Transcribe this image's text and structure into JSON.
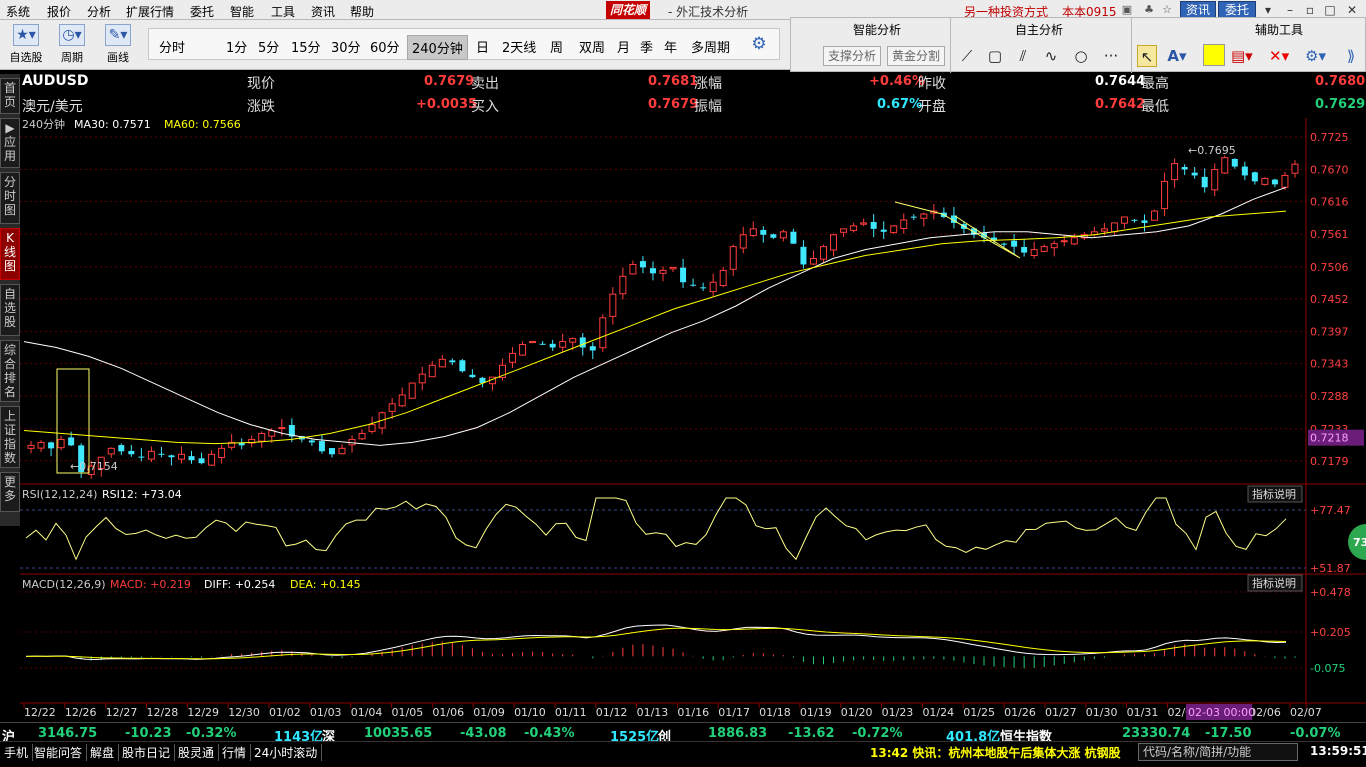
{
  "menu": [
    "系统",
    "报价",
    "分析",
    "扩展行情",
    "委托",
    "智能",
    "工具",
    "资讯",
    "帮助"
  ],
  "app_logo": "同花顺",
  "window_title": "- 外汇技术分析",
  "other_invest": "另一种投资方式",
  "user_name": "本本0915",
  "news_label": "资讯",
  "entrust_label": "委托",
  "toolbar": {
    "self_stock": "自选股",
    "period_label": "周期",
    "draw_label": "画线",
    "periods": [
      "分时",
      "1分",
      "5分",
      "15分",
      "30分",
      "60分",
      "240分钟",
      "日",
      "2天线",
      "周",
      "双周",
      "月",
      "季",
      "年",
      "多周期"
    ],
    "active_period": "240分钟"
  },
  "analysis_panel": {
    "smart_title": "智能分析",
    "self_title": "自主分析",
    "aux_title": "辅助工具",
    "btn_support": "支撑分析",
    "btn_golden": "黄金分割"
  },
  "left_tabs": [
    "首页",
    "应用",
    "分时图",
    "K线图",
    "自选股",
    "综合排名",
    "上证指数",
    "更多"
  ],
  "quote": {
    "symbol": "AUDUSD",
    "name": "澳元/美元",
    "price_label": "现价",
    "price": "0.7679",
    "change_label": "涨跌",
    "change": "+0.0035",
    "sell_label": "卖出",
    "sell": "0.7681",
    "buy_label": "买入",
    "buy": "0.7679",
    "pct_label": "涨幅",
    "pct": "+0.46%",
    "amp_label": "振幅",
    "amp": "0.67%",
    "prev_label": "昨收",
    "prev": "0.7644",
    "open_label": "开盘",
    "open": "0.7642",
    "high_label": "最高",
    "high": "0.7680",
    "low_label": "最低",
    "low": "0.7629"
  },
  "main_legend": {
    "period": "240分钟",
    "ma30": "MA30: 0.7571",
    "ma60": "MA60: 0.7566"
  },
  "rsi_legend": {
    "name": "RSI(12,12,24)",
    "rsi12": "RSI12: +73.04"
  },
  "macd_legend": {
    "name": "MACD(12,26,9)",
    "macd": "MACD: +0.219",
    "diff": "DIFF: +0.254",
    "dea": "DEA: +0.145"
  },
  "indicator_explain": "指标说明",
  "price_axis": [
    "0.7725",
    "0.7670",
    "0.7616",
    "0.7561",
    "0.7506",
    "0.7452",
    "0.7397",
    "0.7343",
    "0.7288",
    "0.7233",
    "0.7179"
  ],
  "current_price_tag": "0.7218",
  "rsi_axis": [
    "+77.47",
    "+51.87"
  ],
  "macd_axis": [
    "+0.478",
    "+0.205",
    "-0.075"
  ],
  "rsi_badge": "73",
  "date_axis": [
    "12/22",
    "12/26",
    "12/27",
    "12/28",
    "12/29",
    "12/30",
    "01/02",
    "01/03",
    "01/04",
    "01/05",
    "01/06",
    "01/09",
    "01/10",
    "01/11",
    "01/12",
    "01/13",
    "01/16",
    "01/17",
    "01/18",
    "01/19",
    "01/20",
    "01/23",
    "01/24",
    "01/25",
    "01/26",
    "01/27",
    "01/30",
    "01/31",
    "02/01",
    "02/02",
    "02/06",
    "02/07"
  ],
  "cursor_date": "02-03 00:00",
  "annot_high": "0.7695",
  "annot_low": "0.7154",
  "chart_data": {
    "type": "candlestick",
    "price_range": [
      0.715,
      0.774
    ],
    "rsi_range": [
      30,
      90
    ],
    "macd_range": [
      -0.3,
      0.55
    ],
    "close_path": [
      0.7205,
      0.721,
      0.72,
      0.7215,
      0.7205,
      0.716,
      0.717,
      0.7185,
      0.72,
      0.7195,
      0.719,
      0.7185,
      0.7195,
      0.719,
      0.7185,
      0.719,
      0.718,
      0.7175,
      0.719,
      0.72,
      0.721,
      0.7205,
      0.7215,
      0.7225,
      0.723,
      0.7235,
      0.722,
      0.7215,
      0.721,
      0.7195,
      0.719,
      0.72,
      0.7215,
      0.7225,
      0.724,
      0.726,
      0.7275,
      0.729,
      0.731,
      0.7325,
      0.734,
      0.735,
      0.7345,
      0.733,
      0.732,
      0.731,
      0.732,
      0.734,
      0.736,
      0.7375,
      0.738,
      0.7375,
      0.737,
      0.738,
      0.7385,
      0.737,
      0.7365,
      0.742,
      0.746,
      0.749,
      0.751,
      0.7505,
      0.7495,
      0.75,
      0.7505,
      0.748,
      0.7475,
      0.747,
      0.748,
      0.75,
      0.754,
      0.756,
      0.757,
      0.756,
      0.7555,
      0.7565,
      0.7545,
      0.751,
      0.752,
      0.754,
      0.756,
      0.757,
      0.7575,
      0.758,
      0.757,
      0.7565,
      0.7575,
      0.7585,
      0.759,
      0.7595,
      0.76,
      0.759,
      0.758,
      0.757,
      0.756,
      0.7555,
      0.755,
      0.7545,
      0.754,
      0.753,
      0.7535,
      0.754,
      0.7545,
      0.755,
      0.7555,
      0.756,
      0.7565,
      0.757,
      0.758,
      0.759,
      0.7585,
      0.758,
      0.76,
      0.765,
      0.768,
      0.767,
      0.766,
      0.764,
      0.767,
      0.769,
      0.7675,
      0.766,
      0.765,
      0.7655,
      0.7645,
      0.766,
      0.7679
    ],
    "ma30_path": [
      0.738,
      0.737,
      0.7355,
      0.7335,
      0.731,
      0.7285,
      0.726,
      0.724,
      0.7225,
      0.7215,
      0.721,
      0.7205,
      0.721,
      0.722,
      0.7235,
      0.726,
      0.729,
      0.732,
      0.7345,
      0.737,
      0.7395,
      0.7415,
      0.744,
      0.747,
      0.7495,
      0.752,
      0.7535,
      0.7545,
      0.7555,
      0.756,
      0.7565,
      0.7565,
      0.756,
      0.7555,
      0.756,
      0.7565,
      0.7575,
      0.7595,
      0.762,
      0.764
    ],
    "ma60_path": [
      0.723,
      0.7225,
      0.722,
      0.7215,
      0.721,
      0.7208,
      0.721,
      0.7215,
      0.7225,
      0.724,
      0.726,
      0.7285,
      0.731,
      0.7335,
      0.736,
      0.7385,
      0.741,
      0.7435,
      0.7455,
      0.7475,
      0.7495,
      0.751,
      0.7525,
      0.7535,
      0.7545,
      0.755,
      0.7552,
      0.7555,
      0.756,
      0.757,
      0.758,
      0.759,
      0.7595,
      0.76
    ]
  },
  "status": {
    "sh_label": "沪",
    "sh_index": "3146.75",
    "sh_change": "-10.23",
    "sh_pct": "-0.32%",
    "sh_amount": "1143亿",
    "sz_label": "深",
    "sz_index": "10035.65",
    "sz_change": "-43.08",
    "sz_pct": "-0.43%",
    "sz_amount": "1525亿",
    "cy_label": "创",
    "cy_index": "1886.83",
    "cy_change": "-13.62",
    "cy_pct": "-0.72%",
    "cy_amount": "401.8亿",
    "hs_label": "恒生指数",
    "hs_index": "23330.74",
    "hs_change": "-17.50",
    "hs_pct": "-0.07%"
  },
  "bottom_tabs": [
    "手机",
    "智能问答",
    "解盘",
    "股市日记",
    "股灵通",
    "行情",
    "24小时滚动"
  ],
  "ticker": "13:42 快讯：杭州本地股午后集体大涨 杭钢股",
  "search_placeholder": "代码/名称/简拼/功能",
  "clock": "13:59:51"
}
